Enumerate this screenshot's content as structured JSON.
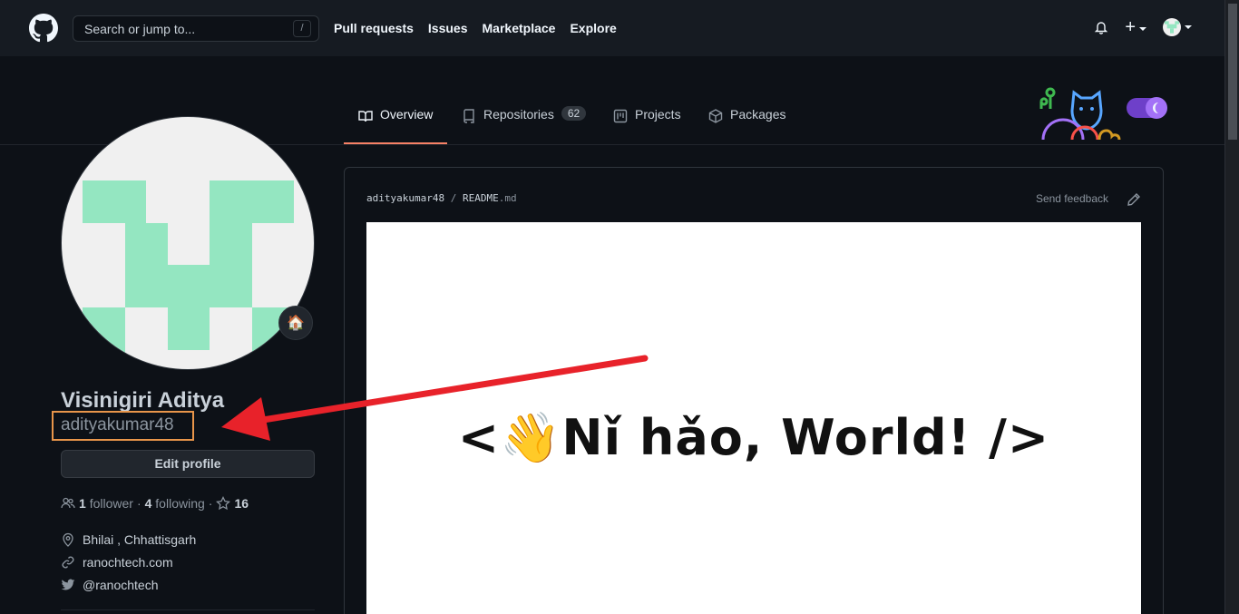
{
  "header": {
    "search_placeholder": "Search or jump to...",
    "search_shortcut": "/",
    "nav": [
      "Pull requests",
      "Issues",
      "Marketplace",
      "Explore"
    ],
    "plus": "+"
  },
  "tabs": [
    {
      "label": "Overview",
      "icon": "book-icon",
      "active": true
    },
    {
      "label": "Repositories",
      "icon": "repo-icon",
      "count": "62"
    },
    {
      "label": "Projects",
      "icon": "project-icon"
    },
    {
      "label": "Packages",
      "icon": "package-icon"
    }
  ],
  "profile": {
    "full_name": "Visinigiri Aditya",
    "username": "adityakumar48",
    "edit_label": "Edit profile",
    "followers_count": "1",
    "followers_label": "follower",
    "following_count": "4",
    "following_label": "following",
    "stars_count": "16",
    "sep": "·",
    "status_emoji": "🏠",
    "location": "Bhilai , Chhattisgarh",
    "website": "ranochtech.com",
    "twitter": "@ranochtech"
  },
  "readme": {
    "owner": "adityakumar48",
    "sep": "/",
    "file": "README",
    "ext": ".md",
    "feedback": "Send feedback",
    "banner_text": "<👋Nǐ hǎo, World! />"
  },
  "colors": {
    "accent_underline": "#f78166",
    "highlight_box": "#e8954a",
    "arrow": "#e8222a",
    "avatar_green": "#94e6c1"
  }
}
